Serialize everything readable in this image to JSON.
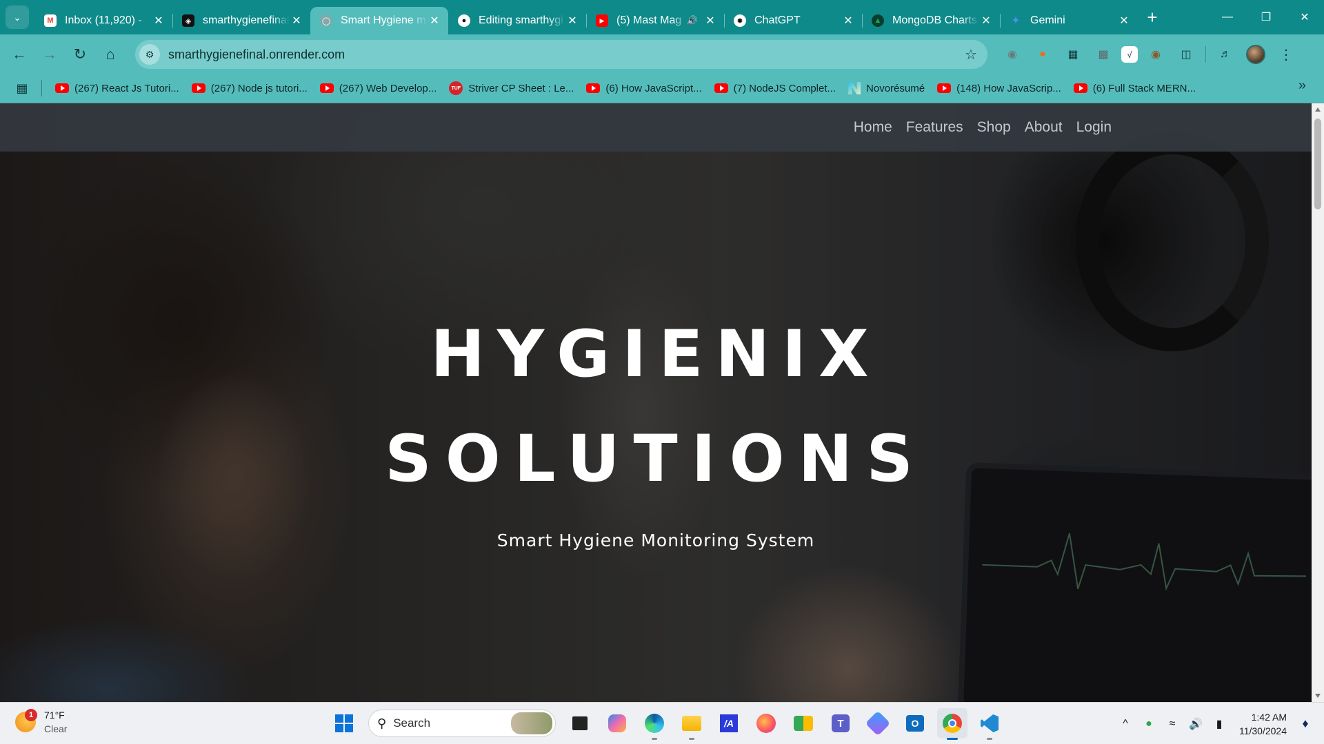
{
  "browser": {
    "tabs": [
      {
        "title": "Inbox (11,920) - ",
        "favicon": "gmail-icon",
        "active": false
      },
      {
        "title": "smarthygienefinal",
        "favicon": "render-icon",
        "active": false
      },
      {
        "title": "Smart Hygiene m",
        "favicon": "globe-icon",
        "active": true
      },
      {
        "title": "Editing smarthygi",
        "favicon": "github-icon",
        "active": false
      },
      {
        "title": "(5) Mast Mag",
        "favicon": "youtube-icon",
        "active": false,
        "audio": true
      },
      {
        "title": "ChatGPT",
        "favicon": "chatgpt-icon",
        "active": false
      },
      {
        "title": "MongoDB Charts",
        "favicon": "mongodb-icon",
        "active": false
      },
      {
        "title": "Gemini",
        "favicon": "gemini-icon",
        "active": false
      }
    ],
    "url": "smarthygienefinal.onrender.com",
    "bookmarks": [
      {
        "label": "(267) React Js Tutori...",
        "icon": "youtube-icon"
      },
      {
        "label": "(267) Node js tutori...",
        "icon": "youtube-icon"
      },
      {
        "label": "(267) Web Develop...",
        "icon": "youtube-icon"
      },
      {
        "label": "Striver CP Sheet : Le...",
        "icon": "takeuforward-icon"
      },
      {
        "label": "(6) How JavaScript...",
        "icon": "youtube-icon"
      },
      {
        "label": "(7) NodeJS Complet...",
        "icon": "youtube-icon"
      },
      {
        "label": "Novorésumé",
        "icon": "novoresume-icon"
      },
      {
        "label": "(148) How JavaScrip...",
        "icon": "youtube-icon"
      },
      {
        "label": "(6) Full Stack MERN...",
        "icon": "youtube-icon"
      }
    ],
    "colors": {
      "tabstrip": "#0f8a8a",
      "toolbar": "#55bcbc"
    }
  },
  "site": {
    "nav": [
      "Home",
      "Features",
      "Shop",
      "About",
      "Login"
    ],
    "hero": {
      "title_line1": "HYGIENIX",
      "title_line2": "SOLUTIONS",
      "subtitle": "Smart Hygiene Monitoring System"
    }
  },
  "taskbar": {
    "weather": {
      "temp": "71°F",
      "condition": "Clear",
      "badge": "1"
    },
    "search_label": "Search",
    "apps": [
      "task-view-icon",
      "copilot-icon",
      "edge-icon",
      "file-explorer-icon",
      "visual-studio-icon",
      "firefox-icon",
      "meet-icon",
      "teams-icon",
      "photos-icon",
      "outlook-icon",
      "chrome-icon",
      "vscode-icon"
    ],
    "time": "1:42 AM",
    "date": "11/30/2024"
  }
}
